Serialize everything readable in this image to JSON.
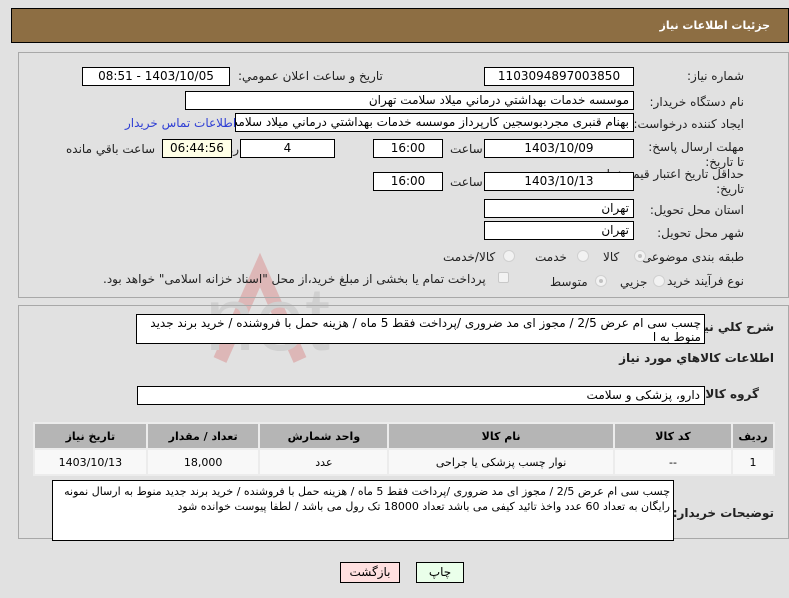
{
  "header": {
    "title": "جزئيات اطلاعات نياز"
  },
  "form": {
    "need_number_label": "شماره نياز:",
    "need_number": "1103094897003850",
    "announce_label": "تاريخ و ساعت اعلان عمومي:",
    "announce_value": "1403/10/05 - 08:51",
    "buyer_org_label": "نام دستگاه خريدار:",
    "buyer_org": "موسسه خدمات بهداشتي درماني ميلاد سلامت تهران",
    "creator_label": "ايجاد کننده درخواست:",
    "creator": "بهنام قنبری مجردبوسجین کارپرداز موسسه خدمات بهداشتي درماني ميلاد سلامت تهران",
    "contact_link": "اطلاعات تماس خريدار",
    "reply_deadline_label": "مهلت ارسال پاسخ: تا تاريخ:",
    "reply_date": "1403/10/09",
    "time_label": "ساعت",
    "reply_time": "16:00",
    "days_value": "4",
    "days_label": "روز و",
    "remaining_time": "06:44:56",
    "remaining_label": "ساعت باقي مانده",
    "price_validity_label": "حداقل تاريخ اعتبار قيمت: تا تاريخ:",
    "price_date": "1403/10/13",
    "price_time": "16:00",
    "province_label": "استان محل تحويل:",
    "province": "تهران",
    "city_label": "شهر محل تحويل:",
    "city": "تهران",
    "category_label": "طبقه بندی موضوعی:",
    "category_options": [
      "کالا",
      "خدمت",
      "کالا/خدمت"
    ],
    "category_selected": "کالا",
    "process_label": "نوع فرآيند خريد :",
    "process_options": [
      "جزيي",
      "متوسط"
    ],
    "process_selected": "متوسط",
    "treasury_note": "پرداخت تمام يا بخشی از مبلغ خريد،از محل \"اسناد خزانه اسلامی\" خواهد بود."
  },
  "description": {
    "label": "شرح کلي نياز:",
    "text": "چسب سی ام عرض 2/5 / مجوز ای مد ضروری /پرداخت فقط 5 ماه / هزینه حمل با فروشنده / خرید برند جدید منوط به  ا"
  },
  "goods": {
    "section_title": "اطلاعات کالاهاي مورد نياز",
    "group_label": "گروه کالا:",
    "group_value": "دارو، پزشکی و سلامت",
    "columns": [
      "رديف",
      "کد کالا",
      "نام کالا",
      "واحد شمارش",
      "تعداد / مقدار",
      "تاريخ نياز"
    ],
    "rows": [
      {
        "index": "1",
        "code": "--",
        "name": "نوار چسب پزشکی یا جراحی",
        "unit": "عدد",
        "qty": "18,000",
        "date": "1403/10/13"
      }
    ]
  },
  "buyer_notes": {
    "label": "توضيحات خريدار:",
    "text": "چسب سی ام عرض 2/5 / مجوز ای مد ضروری /پرداخت فقط 5 ماه / هزینه حمل با فروشنده / خرید برند جدید منوط به ارسال نمونه رایگان به تعداد 60 عدد واخذ تائید کیفی می باشد تعداد 18000 تک رول می باشد  / لطفا پیوست خوانده شود"
  },
  "buttons": {
    "print": "چاپ",
    "back": "بازگشت"
  },
  "colors": {
    "header_bg": "#8d6e43",
    "print_bg": "#eaffea",
    "back_bg": "#ffe0e0",
    "link": "#2f3fd4"
  },
  "watermark": "AriaTender.net"
}
